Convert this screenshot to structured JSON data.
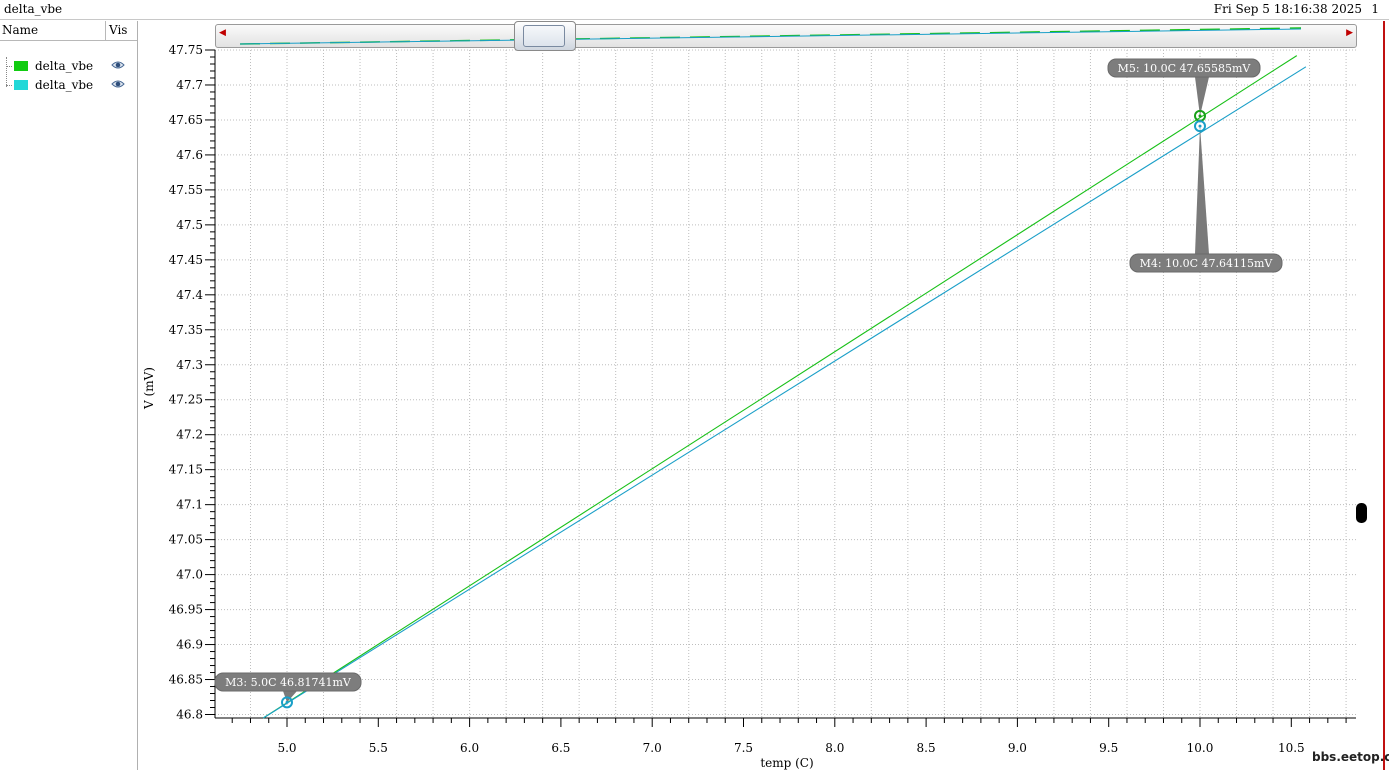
{
  "window": {
    "title": "delta_vbe",
    "timestamp": "Fri Sep 5 18:16:38 2025",
    "page": "1"
  },
  "legend": {
    "col_name": "Name",
    "col_vis": "Vis",
    "items": [
      {
        "label": "delta_vbe",
        "color": "#11cc11",
        "icon": "eye-icon"
      },
      {
        "label": "delta_vbe",
        "color": "#22d8d8",
        "icon": "eye-icon"
      }
    ]
  },
  "watermark": "bbs.eetop.cn",
  "chart_data": {
    "type": "line",
    "xlabel": "temp (C)",
    "ylabel": "V (mV)",
    "xlim": [
      4.6,
      10.9
    ],
    "ylim": [
      46.79,
      47.75
    ],
    "x_ticks": [
      "5.0",
      "5.5",
      "6.0",
      "6.5",
      "7.0",
      "7.5",
      "8.0",
      "8.5",
      "9.0",
      "9.5",
      "10.0",
      "10.5"
    ],
    "y_ticks": [
      "47.75",
      "47.7",
      "47.65",
      "47.6",
      "47.55",
      "47.5",
      "47.45",
      "47.4",
      "47.35",
      "47.3",
      "47.25",
      "47.2",
      "47.15",
      "47.1",
      "47.05",
      "47.0",
      "46.95",
      "46.9",
      "46.85",
      "46.8"
    ],
    "grid": true,
    "series": [
      {
        "name": "delta_vbe",
        "color": "#18c018",
        "x": [
          4.87,
          10.53
        ],
        "y": [
          46.795,
          47.742
        ]
      },
      {
        "name": "delta_vbe",
        "color": "#1a9fc8",
        "x": [
          4.87,
          10.58
        ],
        "y": [
          46.795,
          47.726
        ]
      }
    ],
    "markers": [
      {
        "label": "M5: 10.0C 47.65585mV",
        "x": 10.0,
        "y": 47.65585,
        "color": "#18a018"
      },
      {
        "label": "M4: 10.0C 47.64115mV",
        "x": 10.0,
        "y": 47.64115,
        "color": "#1a9fc8"
      },
      {
        "label": "M3: 5.0C 46.81741mV",
        "x": 5.0,
        "y": 46.81741,
        "color": "#1a9fc8"
      }
    ]
  }
}
